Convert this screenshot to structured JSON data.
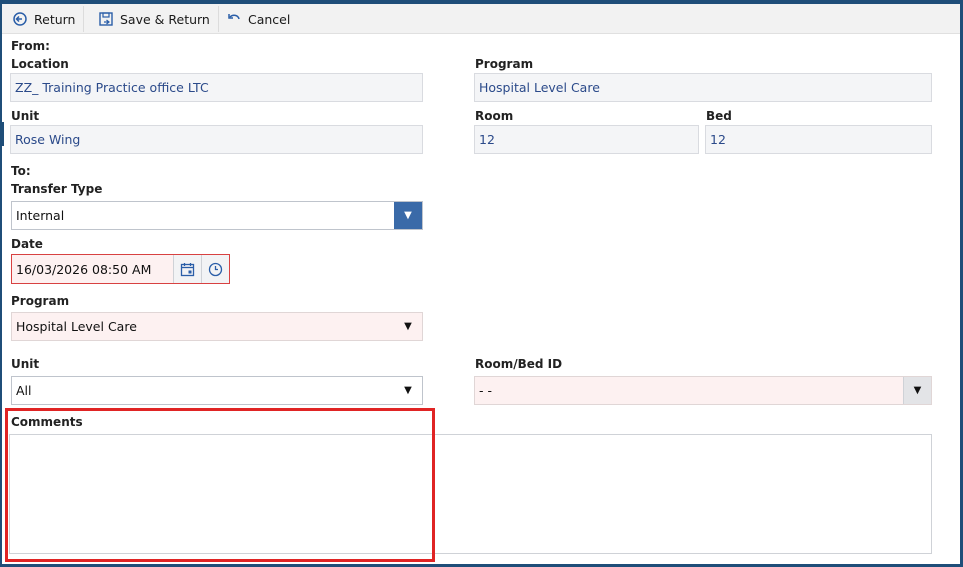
{
  "toolbar": {
    "return_label": "Return",
    "save_return_label": "Save & Return",
    "cancel_label": "Cancel"
  },
  "from": {
    "heading": "From:",
    "location_label": "Location",
    "location_value": "ZZ_ Training Practice office LTC",
    "program_label": "Program",
    "program_value": "Hospital Level Care",
    "unit_label": "Unit",
    "unit_value": "Rose Wing",
    "room_label": "Room",
    "room_value": "12",
    "bed_label": "Bed",
    "bed_value": "12"
  },
  "to": {
    "heading": "To:",
    "transfer_type_label": "Transfer Type",
    "transfer_type_value": "Internal",
    "date_label": "Date",
    "date_value": "16/03/2026 08:50 AM",
    "program_label": "Program",
    "program_value": "Hospital Level Care",
    "unit_label": "Unit",
    "unit_value": "All",
    "room_bed_label": "Room/Bed ID",
    "room_bed_value": "-  -",
    "comments_label": "Comments",
    "comments_value": ""
  },
  "colors": {
    "frame_border": "#1f4e79",
    "highlight": "#e02424",
    "dropdown_accent": "#3a6aa8"
  }
}
